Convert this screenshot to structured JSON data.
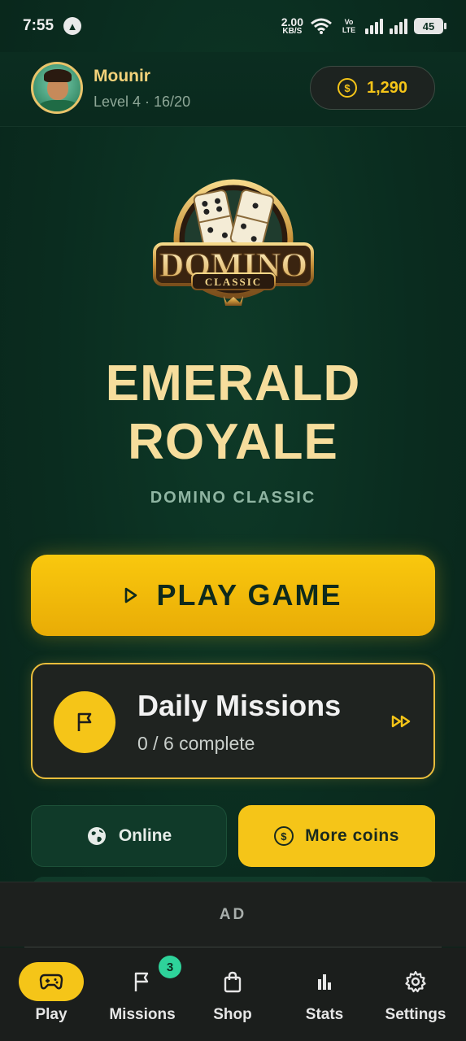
{
  "status_bar": {
    "time": "7:55",
    "network_speed_value": "2.00",
    "network_speed_unit": "KB/S",
    "volte": "Vo LTE",
    "battery": "45"
  },
  "profile": {
    "name": "Mounir",
    "level": "Level 4 · 16/20",
    "coins": "1,290",
    "coin_symbol": "$"
  },
  "logo": {
    "word": "DOMINO",
    "ribbon": "CLASSIC"
  },
  "hero": {
    "title_line1": "EMERALD",
    "title_line2": "ROYALE",
    "subtitle": "DOMINO CLASSIC"
  },
  "play_button": {
    "label": "PLAY GAME"
  },
  "daily_missions": {
    "title": "Daily Missions",
    "progress": "0 / 6 complete"
  },
  "secondary_buttons": {
    "online": "Online",
    "more_coins": "More coins"
  },
  "ad_banner": {
    "label": "AD"
  },
  "bottom_nav": {
    "items": [
      {
        "label": "Play",
        "active": true
      },
      {
        "label": "Missions",
        "badge": "3"
      },
      {
        "label": "Shop"
      },
      {
        "label": "Stats"
      },
      {
        "label": "Settings"
      }
    ]
  },
  "colors": {
    "background": "#0a2c1f",
    "accent_gold": "#f5c518",
    "title_cream": "#f6dd9c",
    "badge_green": "#2ed39a"
  }
}
